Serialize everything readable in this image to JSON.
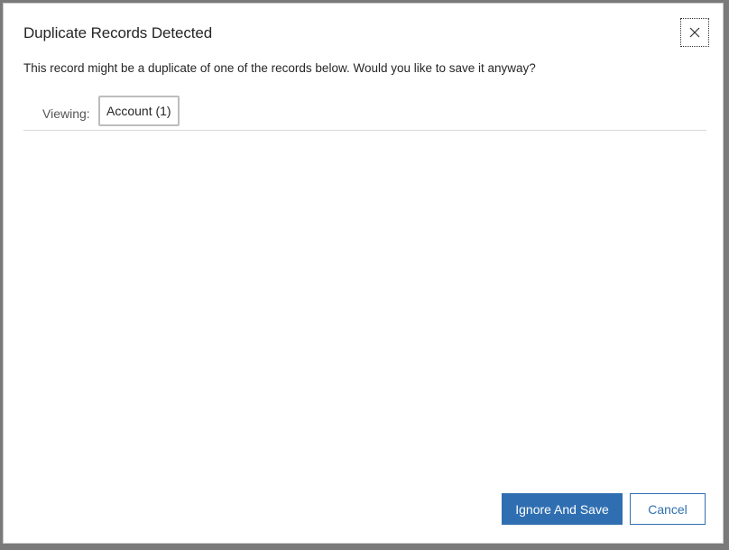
{
  "dialog": {
    "title": "Duplicate Records Detected",
    "message": "This record might be a duplicate of one of the records below. Would you like to save it anyway?",
    "close_icon": "close-icon"
  },
  "viewing": {
    "label": "Viewing:",
    "tabs": [
      {
        "label": "Account (1)",
        "selected": true
      }
    ]
  },
  "footer": {
    "primary_label": "Ignore And Save",
    "secondary_label": "Cancel"
  },
  "colors": {
    "accent": "#2f6fb1",
    "text": "#262626",
    "divider": "#d8d8d8"
  }
}
